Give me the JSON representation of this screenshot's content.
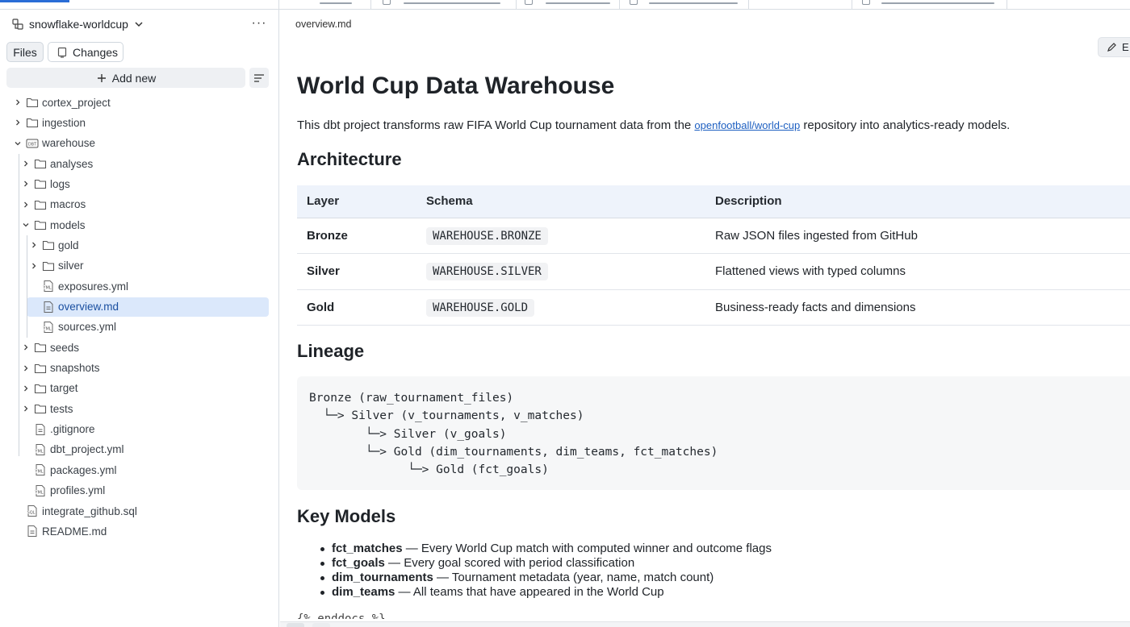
{
  "sidebar": {
    "repo_name": "snowflake-worldcup",
    "more_label": "···",
    "files_tab": "Files",
    "changes_tab": "Changes",
    "add_new": "Add new",
    "tree": [
      {
        "label": "cortex_project",
        "type": "folder"
      },
      {
        "label": "ingestion",
        "type": "folder"
      },
      {
        "label": "warehouse",
        "type": "dbt-folder"
      },
      {
        "label": "analyses",
        "type": "folder"
      },
      {
        "label": "logs",
        "type": "folder"
      },
      {
        "label": "macros",
        "type": "folder"
      },
      {
        "label": "models",
        "type": "folder"
      },
      {
        "label": "gold",
        "type": "folder"
      },
      {
        "label": "silver",
        "type": "folder"
      },
      {
        "label": "exposures.yml",
        "type": "yml"
      },
      {
        "label": "overview.md",
        "type": "md",
        "selected": true
      },
      {
        "label": "sources.yml",
        "type": "yml"
      },
      {
        "label": "seeds",
        "type": "folder"
      },
      {
        "label": "snapshots",
        "type": "folder"
      },
      {
        "label": "target",
        "type": "folder"
      },
      {
        "label": "tests",
        "type": "folder"
      },
      {
        "label": ".gitignore",
        "type": "file"
      },
      {
        "label": "dbt_project.yml",
        "type": "yml"
      },
      {
        "label": "packages.yml",
        "type": "yml"
      },
      {
        "label": "profiles.yml",
        "type": "yml"
      },
      {
        "label": "integrate_github.sql",
        "type": "sql"
      },
      {
        "label": "README.md",
        "type": "md"
      }
    ]
  },
  "main": {
    "breadcrumb": "overview.md",
    "edit_label": "E",
    "title": "World Cup Data Warehouse",
    "intro_before": "This dbt project transforms raw FIFA World Cup tournament data from the ",
    "intro_link": "openfootball/world-cup",
    "intro_after": " repository into analytics-ready models.",
    "architecture_heading": "Architecture",
    "table": {
      "headers": [
        "Layer",
        "Schema",
        "Description"
      ],
      "rows": [
        [
          "Bronze",
          "WAREHOUSE.BRONZE",
          "Raw JSON files ingested from GitHub"
        ],
        [
          "Silver",
          "WAREHOUSE.SILVER",
          "Flattened views with typed columns"
        ],
        [
          "Gold",
          "WAREHOUSE.GOLD",
          "Business-ready facts and dimensions"
        ]
      ]
    },
    "lineage_heading": "Lineage",
    "lineage_lines": [
      "Bronze (raw_tournament_files)",
      "  └─> Silver (v_tournaments, v_matches)",
      "        └─> Silver (v_goals)",
      "        └─> Gold (dim_tournaments, dim_teams, fct_matches)",
      "              └─> Gold (fct_goals)"
    ],
    "key_models_heading": "Key Models",
    "key_models": [
      {
        "name": "fct_matches",
        "desc": " — Every World Cup match with computed winner and outcome flags"
      },
      {
        "name": "fct_goals",
        "desc": " — Every goal scored with period classification"
      },
      {
        "name": "dim_tournaments",
        "desc": " — Tournament metadata (year, name, match count)"
      },
      {
        "name": "dim_teams",
        "desc": " — All teams that have appeared in the World Cup"
      }
    ],
    "end_text": "{% enddocs %}"
  },
  "colors": {
    "accent": "#2a6dd6",
    "selected_bg": "#dbe8fb",
    "table_header_bg": "#eef3fb",
    "link": "#1d5fc1"
  }
}
